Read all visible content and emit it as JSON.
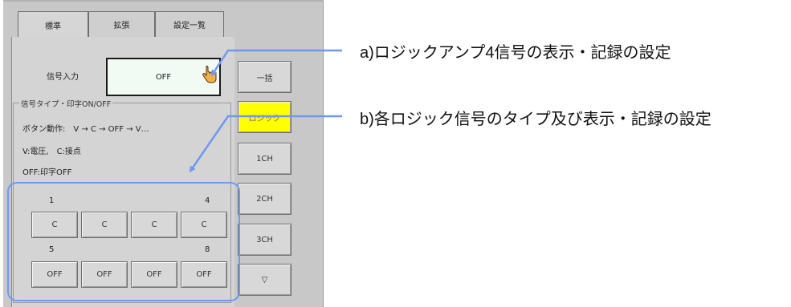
{
  "tabs": [
    {
      "label": "標準",
      "active": true
    },
    {
      "label": "拡張",
      "active": false
    },
    {
      "label": "設定一覧",
      "active": false
    }
  ],
  "signal_input": {
    "label": "信号入力",
    "value": "OFF",
    "cursor_icon": "hand-pointer-icon"
  },
  "signal_type": {
    "legend": "信号タイプ・印字ON/OFF",
    "button_action": "ボタン動作:　V → C → OFF → V…",
    "legend_vc": "V:電圧,　C:接点",
    "legend_off": "OFF:印字OFF"
  },
  "logic_grid": {
    "row1_numbers": {
      "first": "1",
      "last": "4"
    },
    "row1": [
      "C",
      "C",
      "C",
      "C"
    ],
    "row2_numbers": {
      "first": "5",
      "last": "8"
    },
    "row2": [
      "OFF",
      "OFF",
      "OFF",
      "OFF"
    ]
  },
  "side_buttons": {
    "all": "一括",
    "logic": "ロジック",
    "ch1": "1CH",
    "ch2": "2CH",
    "ch3": "3CH",
    "down": "▽"
  },
  "annotations": {
    "a": "a)ロジックアンプ4信号の表示・記録の設定",
    "b": "b)各ロジック信号のタイプ及び表示・記録の設定"
  },
  "colors": {
    "accent": "#6f98f2",
    "highlight_button": "#ffff00",
    "input_bg": "#f2faf4"
  }
}
